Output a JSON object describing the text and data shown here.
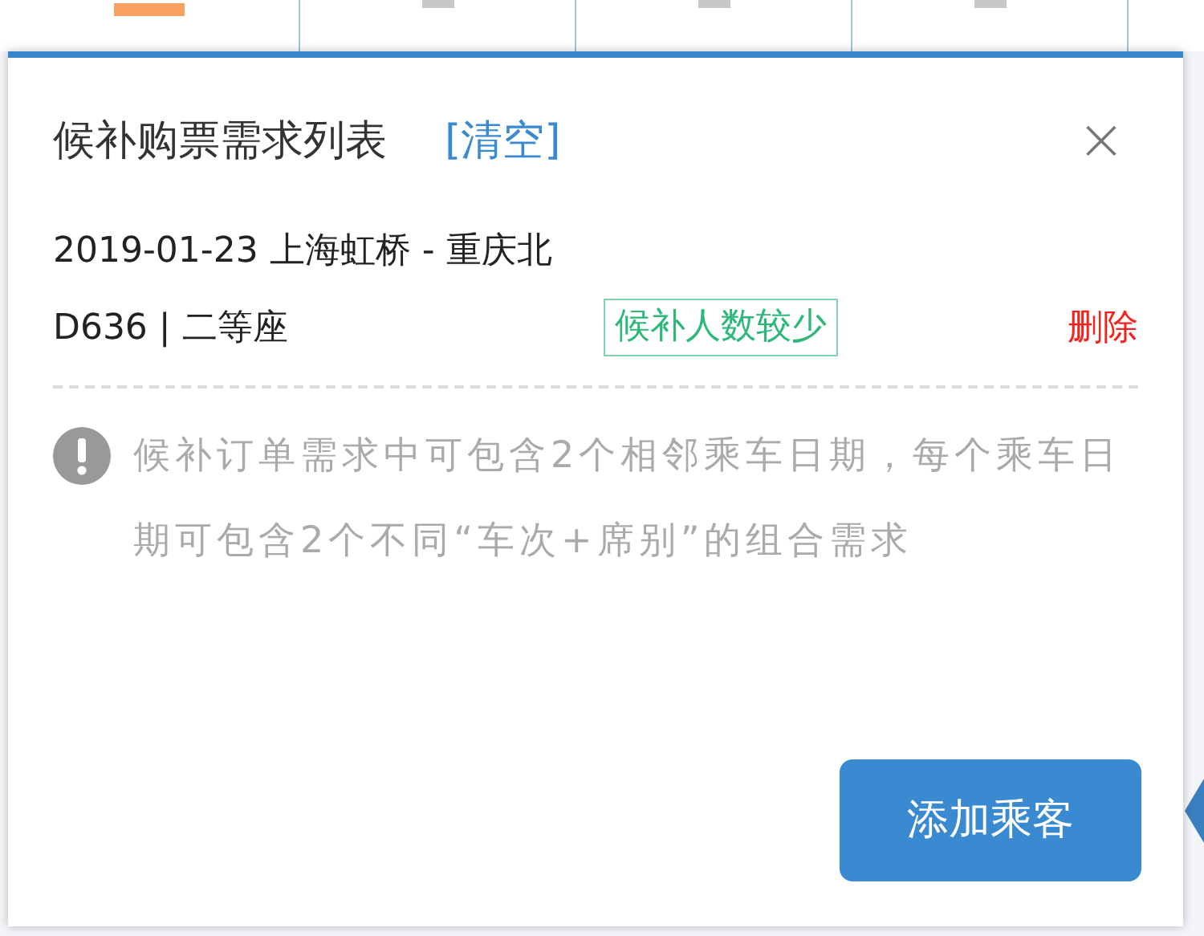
{
  "background_table": {
    "cells": [
      {
        "kind": "status"
      },
      {
        "kind": "empty"
      },
      {
        "kind": "empty"
      },
      {
        "kind": "empty"
      }
    ]
  },
  "panel": {
    "title": "候补购票需求列表",
    "clear_link": "[清空]",
    "close": "×",
    "requests": [
      {
        "route": "2019-01-23 上海虹桥 - 重庆北",
        "train_seat": "D636 | 二等座",
        "tag": "候补人数较少",
        "delete": "删除"
      }
    ],
    "notice": "候补订单需求中可包含2个相邻乘车日期，每个乘车日期可包含2个不同“车次+席别”的组合需求",
    "add_button": "添加乘客"
  }
}
